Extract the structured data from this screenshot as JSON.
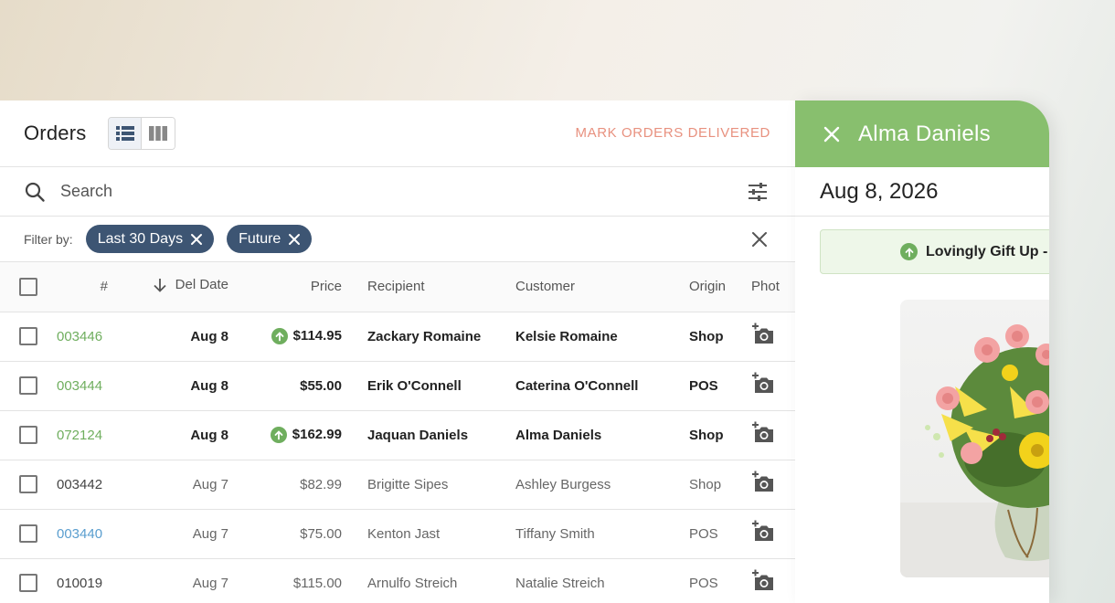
{
  "orders": {
    "title": "Orders",
    "mark_delivered": "MARK ORDERS DELIVERED",
    "view_modes": [
      "list",
      "columns"
    ],
    "search": {
      "placeholder": "Search"
    },
    "filter": {
      "label": "Filter by:",
      "chips": [
        "Last 30 Days",
        "Future"
      ]
    },
    "columns": [
      "#",
      "Del Date",
      "Price",
      "Recipient",
      "Customer",
      "Origin",
      "Phot"
    ],
    "rows": [
      {
        "num": "003446",
        "date": "Aug 8",
        "price": "$114.95",
        "upgrade": true,
        "recipient": "Zackary Romaine",
        "customer": "Kelsie Romaine",
        "origin": "Shop",
        "num_color": "green",
        "bold": true
      },
      {
        "num": "003444",
        "date": "Aug 8",
        "price": "$55.00",
        "upgrade": false,
        "recipient": "Erik O'Connell",
        "customer": "Caterina O'Connell",
        "origin": "POS",
        "num_color": "green",
        "bold": true
      },
      {
        "num": "072124",
        "date": "Aug 8",
        "price": "$162.99",
        "upgrade": true,
        "recipient": "Jaquan Daniels",
        "customer": "Alma Daniels",
        "origin": "Shop",
        "num_color": "green",
        "bold": true
      },
      {
        "num": "003442",
        "date": "Aug 7",
        "price": "$82.99",
        "upgrade": false,
        "recipient": "Brigitte Sipes",
        "customer": "Ashley Burgess",
        "origin": "Shop",
        "num_color": "dark",
        "bold": false
      },
      {
        "num": "003440",
        "date": "Aug 7",
        "price": "$75.00",
        "upgrade": false,
        "recipient": "Kenton Jast",
        "customer": "Tiffany Smith",
        "origin": "POS",
        "num_color": "blue",
        "bold": false
      },
      {
        "num": "010019",
        "date": "Aug 7",
        "price": "$115.00",
        "upgrade": false,
        "recipient": "Arnulfo Streich",
        "customer": "Natalie Streich",
        "origin": "POS",
        "num_color": "dark",
        "bold": false
      }
    ]
  },
  "detail": {
    "name": "Alma Daniels",
    "date": "Aug 8, 2026",
    "banner": "Lovingly Gift Up - G",
    "header_color": "#88bf6e"
  },
  "colors": {
    "accent_green": "#6fae5e",
    "chip_navy": "#3d5573",
    "mark_delivered": "#e8917f",
    "link_blue": "#5a9ecf"
  },
  "icons": [
    "list-view-icon",
    "column-view-icon",
    "search-icon",
    "tune-icon",
    "close-icon",
    "sort-down-icon",
    "upgrade-arrow-icon",
    "add-photo-icon",
    "flower-bouquet-image"
  ]
}
